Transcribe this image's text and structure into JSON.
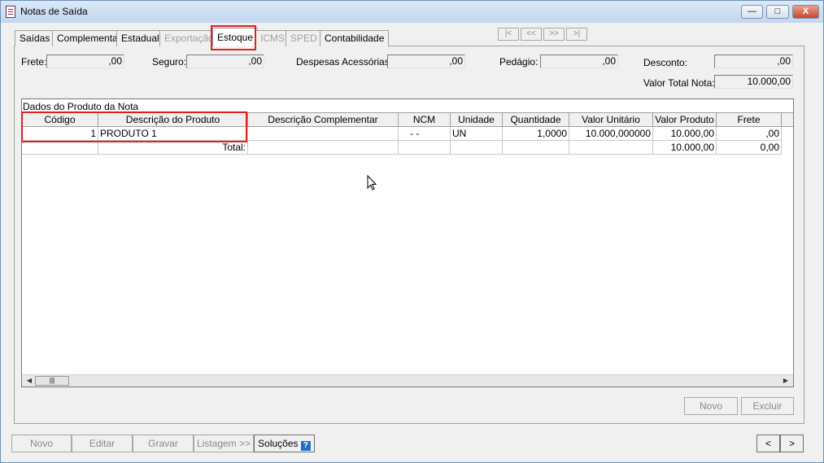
{
  "window": {
    "title": "Notas de Saída"
  },
  "tabs": [
    "Saídas",
    "Complementar",
    "Estadual",
    "Exportação",
    "Estoque",
    "ICMS",
    "SPED",
    "Contabilidade"
  ],
  "nav": {
    "first": "|<",
    "prev": "<<",
    "next": ">>",
    "last": ">|"
  },
  "fields": {
    "frete": {
      "label": "Frete:",
      "value": ",00"
    },
    "seguro": {
      "label": "Seguro:",
      "value": ",00"
    },
    "despesas": {
      "label": "Despesas Acessórias:",
      "value": ",00"
    },
    "pedagio": {
      "label": "Pedágio:",
      "value": ",00"
    },
    "desconto": {
      "label": "Desconto:",
      "value": ",00"
    },
    "valor_total": {
      "label": "Valor Total Nota:",
      "value": "10.000,00"
    }
  },
  "grid": {
    "caption": "Dados do Produto da Nota",
    "headers": [
      "Código",
      "Descrição do Produto",
      "Descrição Complementar",
      "NCM",
      "Unidade",
      "Quantidade",
      "Valor Unitário",
      "Valor Produto",
      "Frete"
    ],
    "row": [
      "1",
      "PRODUTO 1",
      "",
      "- -",
      "UN",
      "1,0000",
      "10.000,000000",
      "10.000,00",
      ",00"
    ],
    "total": {
      "label": "Total:",
      "valor_produto": "10.000,00",
      "frete": "0,00"
    }
  },
  "grid_buttons": {
    "novo": "Novo",
    "excluir": "Excluir"
  },
  "toolbar": {
    "novo": "Novo",
    "editar": "Editar",
    "gravar": "Gravar",
    "listagem": "Listagem >>",
    "solucoes": "Soluções",
    "help": "?"
  },
  "pager": {
    "prev": "<",
    "next": ">"
  },
  "window_buttons": {
    "minimize": "—",
    "maximize": "□",
    "close": "X"
  }
}
